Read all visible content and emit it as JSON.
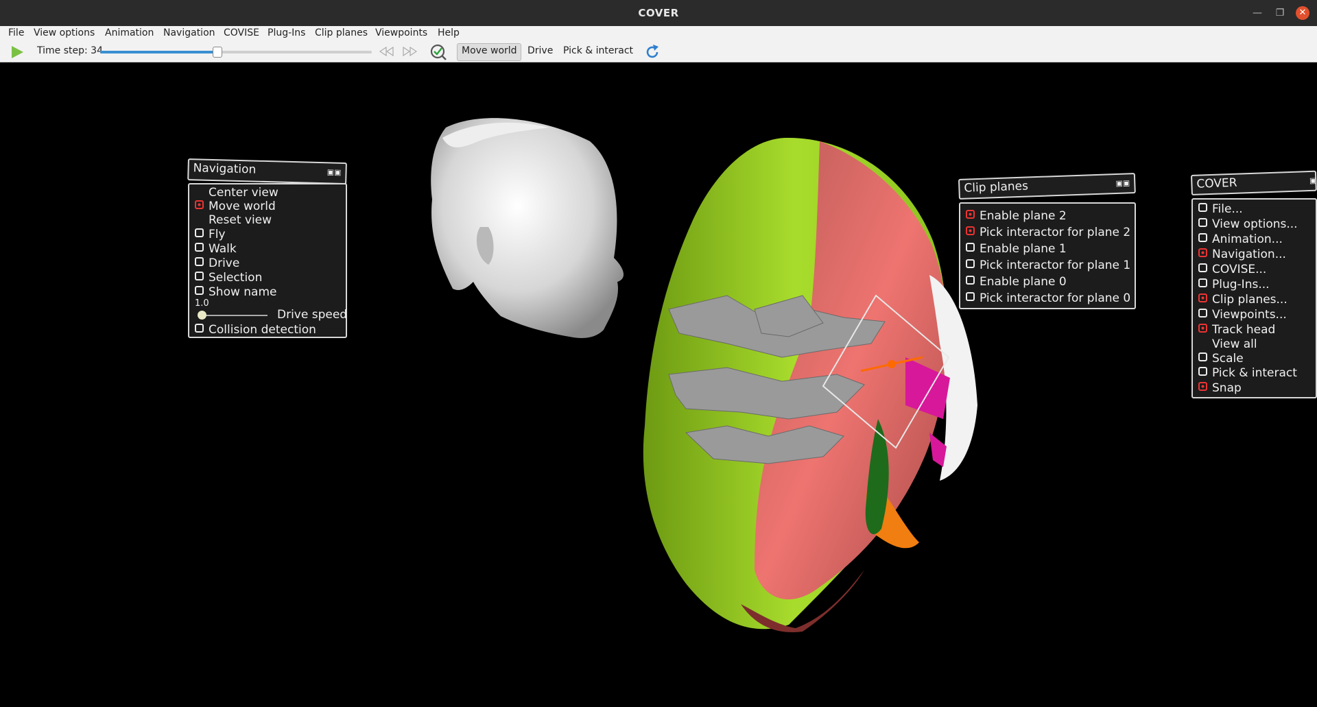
{
  "window": {
    "title": "COVER"
  },
  "menubar": [
    "File",
    "View options",
    "Animation",
    "Navigation",
    "COVISE",
    "Plug-Ins",
    "Clip planes",
    "Viewpoints",
    "Help"
  ],
  "toolbar": {
    "timestep_label": "Time step: 34",
    "timestep_value": 34,
    "slider_fraction": 0.43,
    "move_world": "Move world",
    "drive": "Drive",
    "pick_interact": "Pick & interact"
  },
  "navigation_panel": {
    "title": "Navigation",
    "items": [
      {
        "label": "Center view",
        "check": "none"
      },
      {
        "label": "Move world",
        "check": "on"
      },
      {
        "label": "Reset view",
        "check": "none"
      },
      {
        "label": "Fly",
        "check": "off"
      },
      {
        "label": "Walk",
        "check": "off"
      },
      {
        "label": "Drive",
        "check": "off"
      },
      {
        "label": "Selection",
        "check": "off"
      },
      {
        "label": "Show name",
        "check": "off"
      }
    ],
    "drive_speed_value": "1.0",
    "drive_speed_label": "Drive speed",
    "collision_label": "Collision detection"
  },
  "clip_panel": {
    "title": "Clip planes",
    "items": [
      {
        "label": "Enable plane 2",
        "check": "on"
      },
      {
        "label": "Pick interactor for plane 2",
        "check": "on"
      },
      {
        "label": "Enable plane 1",
        "check": "off"
      },
      {
        "label": "Pick interactor for plane 1",
        "check": "off"
      },
      {
        "label": "Enable plane 0",
        "check": "off"
      },
      {
        "label": "Pick interactor for plane 0",
        "check": "off"
      }
    ]
  },
  "cover_panel": {
    "title": "COVER",
    "items": [
      {
        "label": "File...",
        "check": "off"
      },
      {
        "label": "View options...",
        "check": "off"
      },
      {
        "label": "Animation...",
        "check": "off"
      },
      {
        "label": "Navigation...",
        "check": "on"
      },
      {
        "label": "COVISE...",
        "check": "off"
      },
      {
        "label": "Plug-Ins...",
        "check": "off"
      },
      {
        "label": "Clip planes...",
        "check": "on"
      },
      {
        "label": "Viewpoints...",
        "check": "off"
      },
      {
        "label": "Track head",
        "check": "on"
      },
      {
        "label": "View all",
        "check": "none"
      },
      {
        "label": "Scale",
        "check": "off"
      },
      {
        "label": "Pick & interact",
        "check": "off"
      },
      {
        "label": "Snap",
        "check": "on"
      }
    ]
  },
  "icons": {
    "play": "play-icon",
    "step_back": "step-back-icon",
    "step_forward": "step-forward-icon",
    "view_all": "view-all-icon",
    "reload": "reload-icon"
  },
  "colors": {
    "accent": "#3a8fd1",
    "play_green": "#7ac143",
    "checked_red": "#ee3333",
    "brain_green": "#9ccf2a",
    "brain_red": "#e46a68",
    "magenta": "#d8189a",
    "orange": "#f07e10"
  }
}
